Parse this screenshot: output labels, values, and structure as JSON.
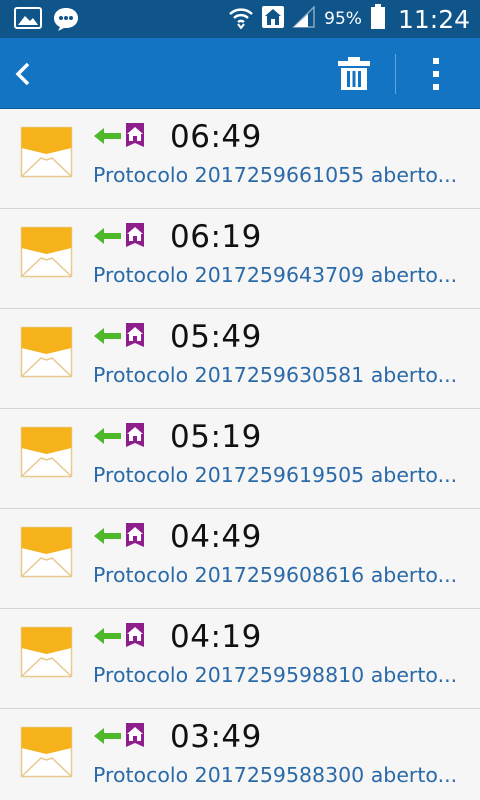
{
  "status_bar": {
    "battery_percent": "95%",
    "time": "11:24",
    "icons": [
      "gallery-icon",
      "chat-icon",
      "wifi-icon",
      "home-notification-icon",
      "signal-icon",
      "battery-icon"
    ]
  },
  "action_bar": {
    "icons": [
      "back-icon",
      "trash-icon",
      "overflow-menu-icon"
    ]
  },
  "colors": {
    "status_bar": "#10558a",
    "action_bar": "#1474c4",
    "preview_text": "#2a6aa8",
    "envelope": "#f5b21a",
    "arrow": "#4cb82a",
    "home_badge": "#8e1e8c"
  },
  "messages": [
    {
      "time": "06:49",
      "preview": "Protocolo 2017259661055 aberto..."
    },
    {
      "time": "06:19",
      "preview": "Protocolo 2017259643709 aberto..."
    },
    {
      "time": "05:49",
      "preview": "Protocolo 2017259630581 aberto..."
    },
    {
      "time": "05:19",
      "preview": "Protocolo 2017259619505 aberto..."
    },
    {
      "time": "04:49",
      "preview": "Protocolo 2017259608616 aberto..."
    },
    {
      "time": "04:19",
      "preview": "Protocolo 2017259598810 aberto..."
    },
    {
      "time": "03:49",
      "preview": "Protocolo 2017259588300 aberto..."
    }
  ]
}
